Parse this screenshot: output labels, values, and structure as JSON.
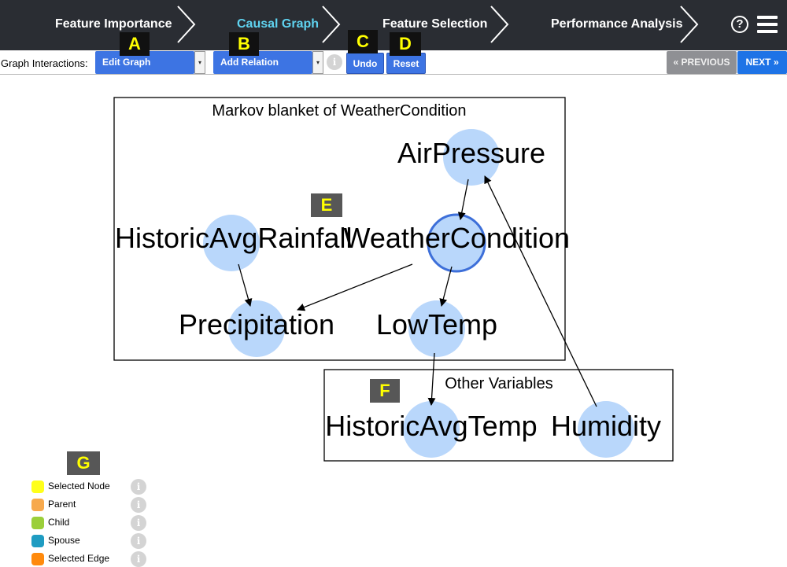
{
  "nav": {
    "steps": [
      {
        "label": "Feature Importance",
        "active": false
      },
      {
        "label": "Causal Graph",
        "active": true
      },
      {
        "label": "Feature Selection",
        "active": false
      },
      {
        "label": "Performance Analysis",
        "active": false
      }
    ],
    "help_icon": "?",
    "menu_icon": "hamburger-menu-icon",
    "active_color": "#5fd3f0",
    "bar_color": "#2a2d33"
  },
  "toolbar": {
    "label": "Graph Interactions:",
    "mode_select": "Edit Graph",
    "relation_select": "Add Relation",
    "info_icon": "i",
    "undo": "Undo",
    "reset": "Reset",
    "previous": "« PREVIOUS",
    "next": "NEXT »",
    "accent": "#3d74e3"
  },
  "callouts": {
    "a": "A",
    "b": "B",
    "c": "C",
    "d": "D",
    "e": "E",
    "f": "F",
    "g": "G"
  },
  "graph": {
    "markov_box_title": "Markov blanket of WeatherCondition",
    "other_box_title": "Other Variables",
    "node_color": "#b9d7fb",
    "selected_node_border": "#3d6fd9",
    "nodes": {
      "air_pressure": "AirPressure",
      "historic_avg_rainfall": "HistoricAvgRainfall",
      "weather_condition": "WeatherCondition",
      "precipitation": "Precipitation",
      "low_temp": "LowTemp",
      "historic_avg_temp": "HistoricAvgTemp",
      "humidity": "Humidity"
    },
    "edges": [
      {
        "from": "AirPressure",
        "to": "WeatherCondition"
      },
      {
        "from": "HistoricAvgRainfall",
        "to": "Precipitation"
      },
      {
        "from": "WeatherCondition",
        "to": "Precipitation"
      },
      {
        "from": "WeatherCondition",
        "to": "LowTemp"
      },
      {
        "from": "LowTemp",
        "to": "HistoricAvgTemp"
      },
      {
        "from": "Humidity",
        "to": "AirPressure"
      }
    ]
  },
  "legend": {
    "items": [
      {
        "label": "Selected Node",
        "color": "#ffff1a"
      },
      {
        "label": "Parent",
        "color": "#f7a94d"
      },
      {
        "label": "Child",
        "color": "#9bcf3a"
      },
      {
        "label": "Spouse",
        "color": "#1f9cc2"
      },
      {
        "label": "Selected Edge",
        "color": "#ff8a0d"
      }
    ],
    "info_icon": "i"
  }
}
